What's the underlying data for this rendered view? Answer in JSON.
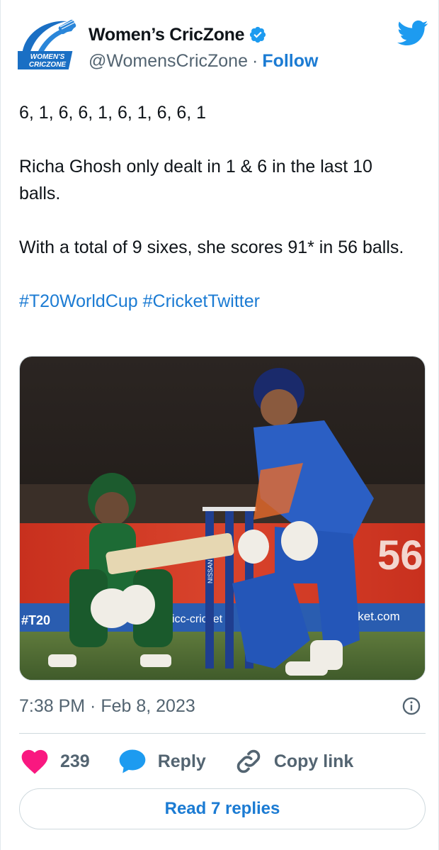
{
  "author": {
    "name": "Women’s CricZone",
    "handle": "@WomensCricZone",
    "separator": "·",
    "follow_label": "Follow",
    "logo_text_line1": "WOMEN'S",
    "logo_text_line2": "CRICZONE"
  },
  "tweet": {
    "line1": "6, 1, 6, 6, 1, 6, 1, 6, 6, 1",
    "line2": "Richa Ghosh only dealt in 1 & 6 in the last 10 balls.",
    "line3": "With a total of 9 sixes, she scores 91* in 56 balls.",
    "hashtags": [
      "#T20WorldCup",
      "#CricketTwitter"
    ]
  },
  "media": {
    "board_left": "#T20",
    "board_mid": "icc-cricket",
    "board_right": "icket.com",
    "stump_text": "NISSAN"
  },
  "meta": {
    "timestamp": "7:38 PM · Feb 8, 2023"
  },
  "actions": {
    "likes": "239",
    "reply_label": "Reply",
    "copy_label": "Copy link"
  },
  "read_replies_label": "Read 7 replies",
  "colors": {
    "accent": "#1b7bd3",
    "heart": "#f91880",
    "twitter_blue": "#1d9bf0",
    "muted": "#536471"
  }
}
